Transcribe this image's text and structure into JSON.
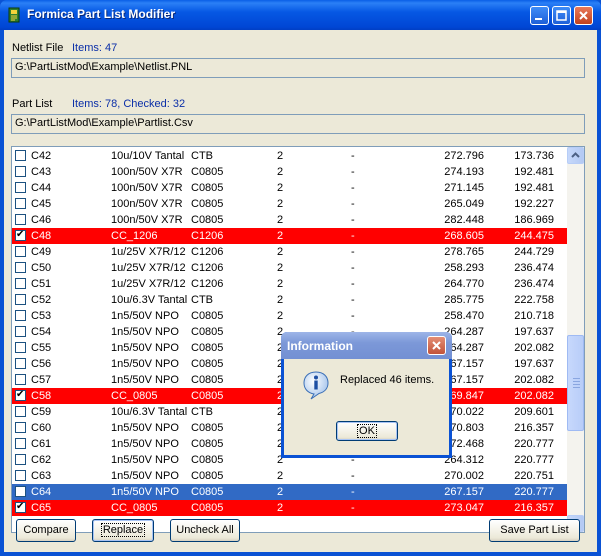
{
  "window": {
    "title": "Formica Part List Modifier"
  },
  "netlist": {
    "label": "Netlist File",
    "items": "Items: 47",
    "path": "G:\\PartListMod\\Example\\Netlist.PNL"
  },
  "partlist": {
    "label": "Part List",
    "items": "Items: 78, Checked: 32",
    "path": "G:\\PartListMod\\Example\\Partlist.Csv"
  },
  "rows": [
    {
      "ref": "C42",
      "value": "10u/10V Tantal",
      "pkg": "CTB",
      "layer": "2",
      "rot": "-",
      "x": "272.796",
      "y": "173.736",
      "checked": false,
      "state": "normal"
    },
    {
      "ref": "C43",
      "value": "100n/50V X7R",
      "pkg": "C0805",
      "layer": "2",
      "rot": "-",
      "x": "274.193",
      "y": "192.481",
      "checked": false,
      "state": "normal"
    },
    {
      "ref": "C44",
      "value": "100n/50V X7R",
      "pkg": "C0805",
      "layer": "2",
      "rot": "-",
      "x": "271.145",
      "y": "192.481",
      "checked": false,
      "state": "normal"
    },
    {
      "ref": "C45",
      "value": "100n/50V X7R",
      "pkg": "C0805",
      "layer": "2",
      "rot": "-",
      "x": "265.049",
      "y": "192.227",
      "checked": false,
      "state": "normal"
    },
    {
      "ref": "C46",
      "value": "100n/50V X7R",
      "pkg": "C0805",
      "layer": "2",
      "rot": "-",
      "x": "282.448",
      "y": "186.969",
      "checked": false,
      "state": "normal"
    },
    {
      "ref": "C48",
      "value": "CC_1206",
      "pkg": "C1206",
      "layer": "2",
      "rot": "-",
      "x": "268.605",
      "y": "244.475",
      "checked": true,
      "state": "red"
    },
    {
      "ref": "C49",
      "value": "1u/25V X7R/12",
      "pkg": "C1206",
      "layer": "2",
      "rot": "-",
      "x": "278.765",
      "y": "244.729",
      "checked": false,
      "state": "normal"
    },
    {
      "ref": "C50",
      "value": "1u/25V X7R/12",
      "pkg": "C1206",
      "layer": "2",
      "rot": "-",
      "x": "258.293",
      "y": "236.474",
      "checked": false,
      "state": "normal"
    },
    {
      "ref": "C51",
      "value": "1u/25V X7R/12",
      "pkg": "C1206",
      "layer": "2",
      "rot": "-",
      "x": "264.770",
      "y": "236.474",
      "checked": false,
      "state": "normal"
    },
    {
      "ref": "C52",
      "value": "10u/6.3V Tantal",
      "pkg": "CTB",
      "layer": "2",
      "rot": "-",
      "x": "285.775",
      "y": "222.758",
      "checked": false,
      "state": "normal"
    },
    {
      "ref": "C53",
      "value": "1n5/50V NPO",
      "pkg": "C0805",
      "layer": "2",
      "rot": "-",
      "x": "258.470",
      "y": "210.718",
      "checked": false,
      "state": "normal"
    },
    {
      "ref": "C54",
      "value": "1n5/50V NPO",
      "pkg": "C0805",
      "layer": "2",
      "rot": "-",
      "x": "264.287",
      "y": "197.637",
      "checked": false,
      "state": "normal"
    },
    {
      "ref": "C55",
      "value": "1n5/50V NPO",
      "pkg": "C0805",
      "layer": "2",
      "rot": "-",
      "x": "264.287",
      "y": "202.082",
      "checked": false,
      "state": "normal"
    },
    {
      "ref": "C56",
      "value": "1n5/50V NPO",
      "pkg": "C0805",
      "layer": "2",
      "rot": "-",
      "x": "267.157",
      "y": "197.637",
      "checked": false,
      "state": "normal"
    },
    {
      "ref": "C57",
      "value": "1n5/50V NPO",
      "pkg": "C0805",
      "layer": "2",
      "rot": "-",
      "x": "267.157",
      "y": "202.082",
      "checked": false,
      "state": "normal"
    },
    {
      "ref": "C58",
      "value": "CC_0805",
      "pkg": "C0805",
      "layer": "2",
      "rot": "-",
      "x": "269.847",
      "y": "202.082",
      "checked": true,
      "state": "red"
    },
    {
      "ref": "C59",
      "value": "10u/6.3V Tantal",
      "pkg": "CTB",
      "layer": "2",
      "rot": "-",
      "x": "270.022",
      "y": "209.601",
      "checked": false,
      "state": "normal"
    },
    {
      "ref": "C60",
      "value": "1n5/50V NPO",
      "pkg": "C0805",
      "layer": "2",
      "rot": "-",
      "x": "270.803",
      "y": "216.357",
      "checked": false,
      "state": "normal"
    },
    {
      "ref": "C61",
      "value": "1n5/50V NPO",
      "pkg": "C0805",
      "layer": "2",
      "rot": "-",
      "x": "272.468",
      "y": "220.777",
      "checked": false,
      "state": "normal"
    },
    {
      "ref": "C62",
      "value": "1n5/50V NPO",
      "pkg": "C0805",
      "layer": "2",
      "rot": "-",
      "x": "264.312",
      "y": "220.777",
      "checked": false,
      "state": "normal"
    },
    {
      "ref": "C63",
      "value": "1n5/50V NPO",
      "pkg": "C0805",
      "layer": "2",
      "rot": "-",
      "x": "270.002",
      "y": "220.751",
      "checked": false,
      "state": "normal"
    },
    {
      "ref": "C64",
      "value": "1n5/50V NPO",
      "pkg": "C0805",
      "layer": "2",
      "rot": "-",
      "x": "267.157",
      "y": "220.777",
      "checked": false,
      "state": "selected"
    },
    {
      "ref": "C65",
      "value": "CC_0805",
      "pkg": "C0805",
      "layer": "2",
      "rot": "-",
      "x": "273.047",
      "y": "216.357",
      "checked": true,
      "state": "red"
    }
  ],
  "buttons": {
    "compare": "Compare",
    "replace": "Replace",
    "uncheck_all": "Uncheck All",
    "save": "Save Part List"
  },
  "dialog": {
    "title": "Information",
    "message": "Replaced 46 items.",
    "ok": "OK"
  },
  "icons": {
    "app": "app-icon",
    "info": "info-icon",
    "minimize": "minimize-icon",
    "maximize": "maximize-icon",
    "close": "close-icon"
  },
  "colors": {
    "checked_row": "#ff0000",
    "selected_row": "#316ac5",
    "titlebar": "#0046d5",
    "dialog_titlebar": "#7c98d8"
  }
}
